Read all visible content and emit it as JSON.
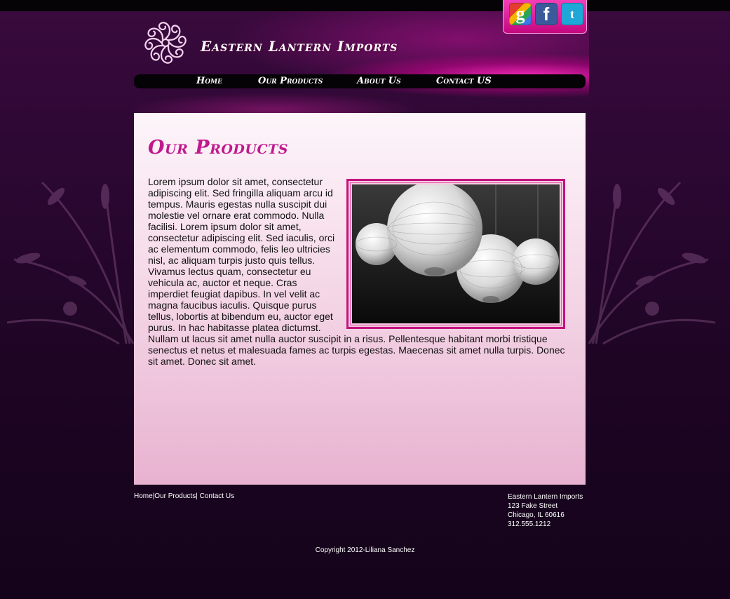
{
  "site": {
    "title": "Eastern Lantern Imports"
  },
  "social": [
    {
      "name": "google",
      "glyph": "g"
    },
    {
      "name": "facebook",
      "glyph": "f"
    },
    {
      "name": "twitter",
      "glyph": "t"
    }
  ],
  "nav": [
    {
      "label": "Home"
    },
    {
      "label": "Our Products"
    },
    {
      "label": "About Us"
    },
    {
      "label": "Contact US"
    }
  ],
  "main": {
    "heading": "Our Products",
    "body": "Lorem ipsum dolor sit amet, consectetur adipiscing elit. Sed fringilla aliquam arcu id tempus. Mauris egestas nulla suscipit dui molestie vel ornare erat commodo. Nulla facilisi. Lorem ipsum dolor sit amet, consectetur adipiscing elit. Sed iaculis, orci ac elementum commodo, felis leo ultricies nisl, ac aliquam turpis justo quis tellus. Vivamus lectus quam, consectetur eu vehicula ac, auctor et neque. Cras imperdiet feugiat dapibus. In vel velit ac magna faucibus iaculis. Quisque purus tellus, lobortis at bibendum eu, auctor eget purus. In hac habitasse platea dictumst. Nullam ut lacus sit amet nulla auctor suscipit in a risus. Pellentesque habitant morbi tristique senectus et netus et malesuada fames ac turpis egestas. Maecenas sit amet nulla turpis. Donec sit amet. Donec sit amet."
  },
  "footer": {
    "links": [
      "Home",
      "Our Products",
      " Contact Us"
    ],
    "separator": "|",
    "address": {
      "name": "Eastern Lantern Imports",
      "street": "123 Fake Street",
      "city": "Chicago, IL 60616",
      "phone": "312.555.1212"
    },
    "copyright": "Copyright 2012-Liliana Sanchez"
  },
  "colors": {
    "accent": "#c0188d",
    "background": "#2e0834"
  }
}
